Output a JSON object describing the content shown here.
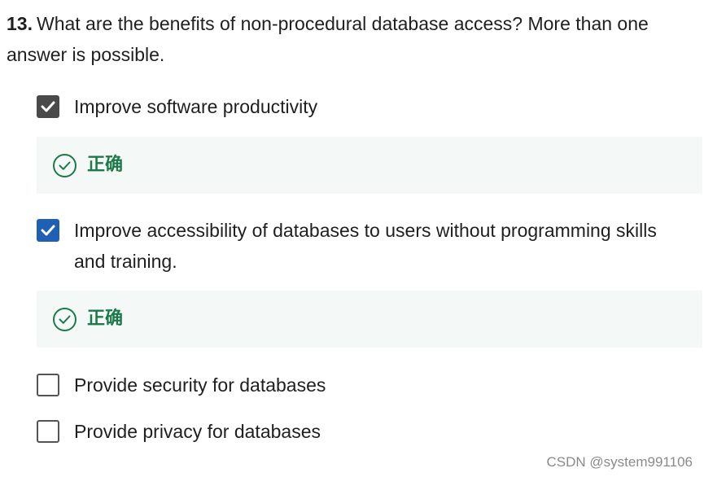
{
  "question": {
    "number": "13.",
    "text": "What are the benefits of non-procedural database access? More than one answer is possible."
  },
  "options": [
    {
      "label": "Improve software productivity",
      "checked": true,
      "feedback": "正确"
    },
    {
      "label": "Improve accessibility of databases to users without programming skills and training.",
      "checked": true,
      "feedback": "正确"
    },
    {
      "label": "Provide security for databases",
      "checked": false
    },
    {
      "label": "Provide privacy for databases",
      "checked": false
    }
  ],
  "watermark": "CSDN @system991106",
  "colors": {
    "correct_green": "#1c7a4a",
    "feedback_bg": "#f4f8f6",
    "checkbox_gray": "#4a4a4a",
    "checkbox_blue": "#1f5fb4"
  },
  "icons": {
    "checkbox_checked": "check-icon",
    "correct": "check-circle-icon"
  }
}
